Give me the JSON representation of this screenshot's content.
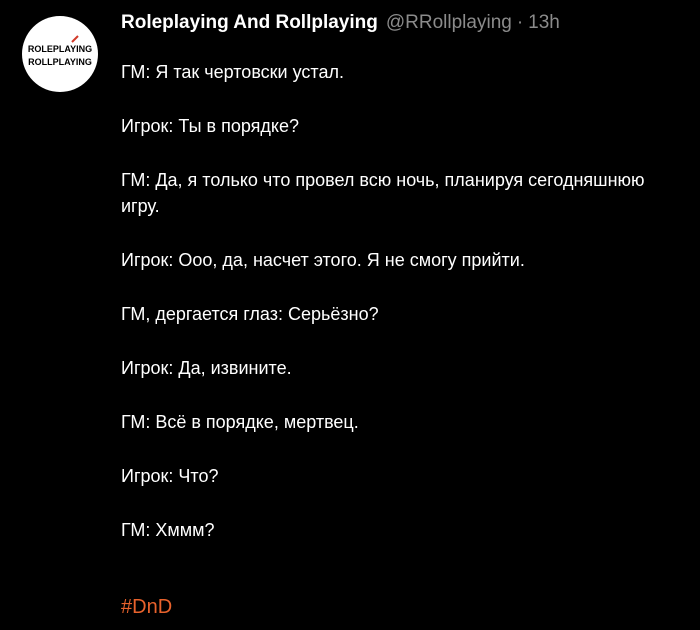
{
  "post": {
    "author": {
      "display_name": "Roleplaying And Rollplaying",
      "handle": "@RRollplaying",
      "separator": "·",
      "time": "13h",
      "avatar": {
        "logo_text_line1": "ROLEPLAYING",
        "logo_text_line2": "ROLLPLAYING",
        "icon": "logo-icon"
      }
    },
    "lines": [
      "ГМ: Я так чертовски устал.",
      "Игрок: Ты в порядке?",
      "ГМ: Да, я только что провел всю ночь, планируя сегодняшнюю игру.",
      "Игрок: Ооо, да, насчет этого. Я не смогу прийти.",
      "ГМ, дергается глаз: Серьёзно?",
      "Игрок: Да, извините.",
      "ГМ: Всё в порядке, мертвец.",
      "Игрок: Что?",
      "ГМ: Хммм?"
    ],
    "hashtag": "#DnD"
  },
  "colors": {
    "background": "#000000",
    "text": "#ffffff",
    "muted": "#8b8b8b",
    "hashtag": "#e8622c"
  }
}
